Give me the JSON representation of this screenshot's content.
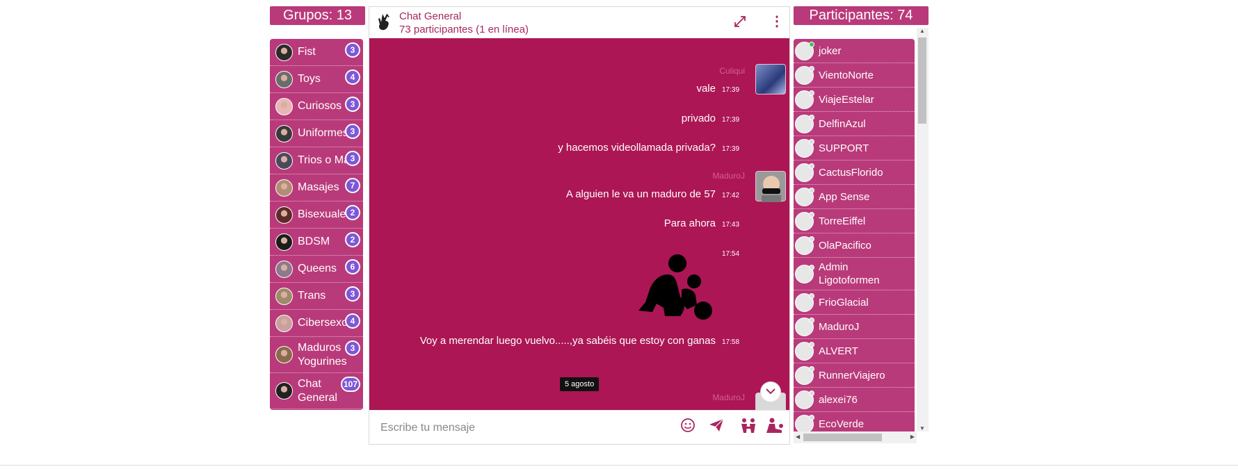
{
  "groups": {
    "header": "Grupos: 13",
    "items": [
      {
        "label": "Fist",
        "count": "3",
        "avatar_color": "#2b2b2b"
      },
      {
        "label": "Toys",
        "count": "4",
        "avatar_color": "#6c6c6c"
      },
      {
        "label": "Curiosos",
        "count": "3",
        "avatar_color": "#e9b5b5"
      },
      {
        "label": "Uniformes",
        "count": "3",
        "avatar_color": "#3a3a3a"
      },
      {
        "label": "Trios o Más",
        "count": "3",
        "avatar_color": "#4a4a5a"
      },
      {
        "label": "Masajes",
        "count": "7",
        "avatar_color": "#b38c75"
      },
      {
        "label": "Bisexuales",
        "count": "2",
        "avatar_color": "#5e2a2a"
      },
      {
        "label": "BDSM",
        "count": "2",
        "avatar_color": "#1c1c1c"
      },
      {
        "label": "Queens",
        "count": "6",
        "avatar_color": "#8c7a8c"
      },
      {
        "label": "Trans",
        "count": "3",
        "avatar_color": "#a08a6a"
      },
      {
        "label": "Cibersexo",
        "count": "4",
        "avatar_color": "#c9a0a0"
      },
      {
        "label": "Maduros Yogurines",
        "count": "3",
        "avatar_color": "#8a6a4a"
      },
      {
        "label": "Chat General",
        "count": "107",
        "avatar_color": "#222222"
      }
    ]
  },
  "chat": {
    "title": "Chat General",
    "subtitle": "73 participantes (1 en línea)",
    "messages": [
      {
        "text": "vale",
        "time": "17:39"
      },
      {
        "text": "privado",
        "time": "17:39"
      },
      {
        "text": "y hacemos videollamada privada?",
        "time": "17:39"
      },
      {
        "text": "A alguien le va un maduro de 57",
        "time": "17:42"
      },
      {
        "text": "Para ahora",
        "time": "17:43"
      },
      {
        "text": "",
        "time": "17:54"
      },
      {
        "text": "Voy a merendar luego vuelvo.....,ya sabéis que estoy con ganas",
        "time": "17:58"
      }
    ],
    "senders": [
      "Culiqui",
      "MaduroJ",
      "MaduroJ"
    ],
    "date_divider": "5 agosto",
    "input_placeholder": "Escribe tu mensaje",
    "icons": [
      "expand-icon",
      "menu-icon",
      "scroll-down-icon",
      "emoji-icon",
      "send-icon",
      "sticker-icon",
      "position-icon"
    ]
  },
  "participants": {
    "header": "Participantes: 74",
    "items": [
      {
        "name": "joker",
        "online": true
      },
      {
        "name": "VientoNorte",
        "online": false
      },
      {
        "name": "ViajeEstelar",
        "online": false
      },
      {
        "name": "DelfinAzul",
        "online": false
      },
      {
        "name": "SUPPORT",
        "online": false
      },
      {
        "name": "CactusFlorido",
        "online": false
      },
      {
        "name": "App Sense",
        "online": false
      },
      {
        "name": "TorreEiffel",
        "online": false
      },
      {
        "name": "OlaPacifico",
        "online": false
      },
      {
        "name": "Admin Ligotoformen",
        "online": false
      },
      {
        "name": "FrioGlacial",
        "online": false
      },
      {
        "name": "MaduroJ",
        "online": false
      },
      {
        "name": "ALVERT",
        "online": false
      },
      {
        "name": "RunnerViajero",
        "online": false
      },
      {
        "name": "alexei76",
        "online": false
      },
      {
        "name": "EcoVerde",
        "online": false
      }
    ]
  },
  "colors": {
    "panel": "#b93a7a",
    "chat_bg": "#ac1654",
    "badge": "#7e57d6",
    "accent": "#a8265f"
  }
}
